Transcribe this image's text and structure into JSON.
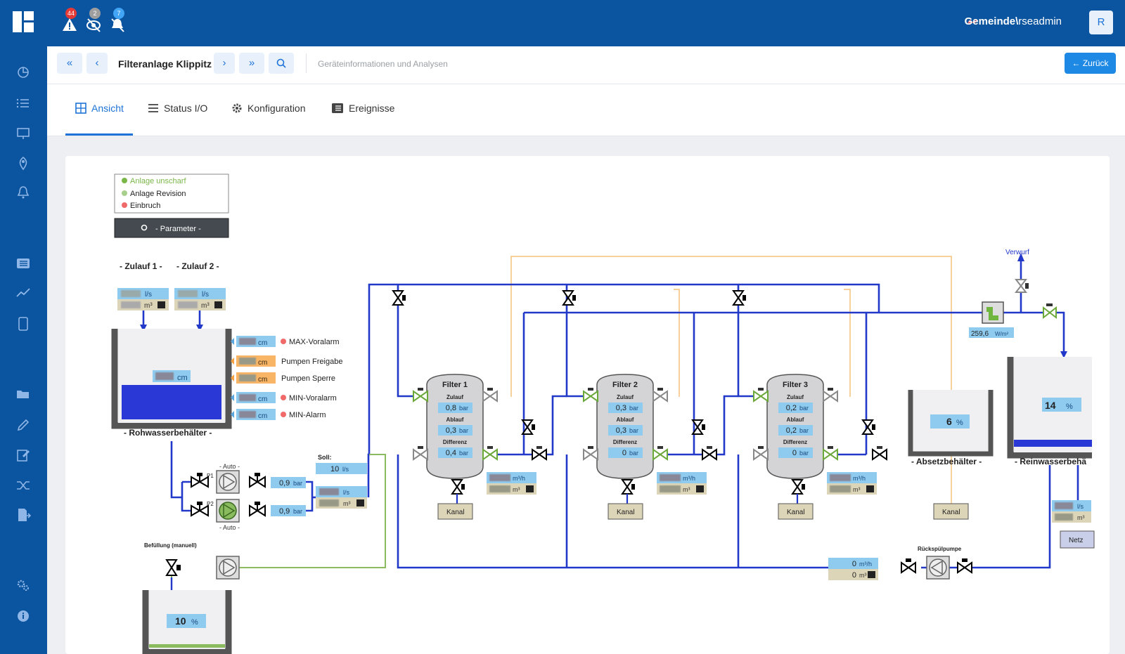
{
  "header": {
    "badges": [
      "44",
      "2",
      "7"
    ],
    "user_domain": "Gemeinde\\",
    "user_name": "rseadmin",
    "avatar": "R"
  },
  "breadcrumb": {
    "title": "Filteranlage Klippitz",
    "subtitle": "Geräteinformationen und Analysen",
    "back_label": "Zurück"
  },
  "tabs": [
    {
      "label": "Ansicht",
      "icon": "grid-icon",
      "active": true
    },
    {
      "label": "Status I/O",
      "icon": "menu-icon"
    },
    {
      "label": "Konfiguration",
      "icon": "gear-icon"
    },
    {
      "label": "Ereignisse",
      "icon": "list-icon"
    }
  ],
  "legend": {
    "items": [
      {
        "label": "Anlage unscharf",
        "color": "#7ab648"
      },
      {
        "label": "Anlage Revision",
        "color": "#a8d08d"
      },
      {
        "label": "Einbruch",
        "color": "#f06a6a"
      }
    ],
    "param_button": "- Parameter -"
  },
  "diagram": {
    "zulauf1": "- Zulauf 1 -",
    "zulauf2": "- Zulauf 2 -",
    "unit_ls": "l/s",
    "unit_m3": "m³",
    "unit_cm": "cm",
    "unit_bar": "bar",
    "unit_m3h": "m³/h",
    "rohwasser": "- Rohwasserbehälter -",
    "level_labels": [
      "MAX-Voralarm",
      "Pumpen Freigabe",
      "Pumpen Sperre",
      "MIN-Voralarm",
      "MIN-Alarm"
    ],
    "pump_auto": "- Auto -",
    "p1": "P1",
    "p2": "P2",
    "p1_pressure": "0,9",
    "p2_pressure": "0,9",
    "soll_label": "Soll:",
    "soll_value": "10",
    "befuellung": "Befüllung (manuell)",
    "small_tank_level": "10",
    "filters": [
      {
        "name": "Filter 1",
        "zulauf": "0,8",
        "ablauf": "0,3",
        "differenz": "0,4"
      },
      {
        "name": "Filter 2",
        "zulauf": "0,3",
        "ablauf": "0,3",
        "differenz": "0"
      },
      {
        "name": "Filter 3",
        "zulauf": "0,2",
        "ablauf": "0,2",
        "differenz": "0"
      }
    ],
    "filter_labels": {
      "zulauf": "Zulauf",
      "ablauf": "Ablauf",
      "differenz": "Differenz"
    },
    "kanal": "Kanal",
    "absetz_level": "6",
    "absetz_label": "- Absetzbehälter -",
    "rein_level": "14",
    "rein_label": "- Reinwasserbehä",
    "verwurf": "Verwurf",
    "irradiance": "259,6",
    "irradiance_unit": "W/m²",
    "netz": "Netz",
    "ruecksp_label": "Rückspülpumpe",
    "ruecksp_flow": "0",
    "ruecksp_total": "0",
    "percent": "%"
  }
}
